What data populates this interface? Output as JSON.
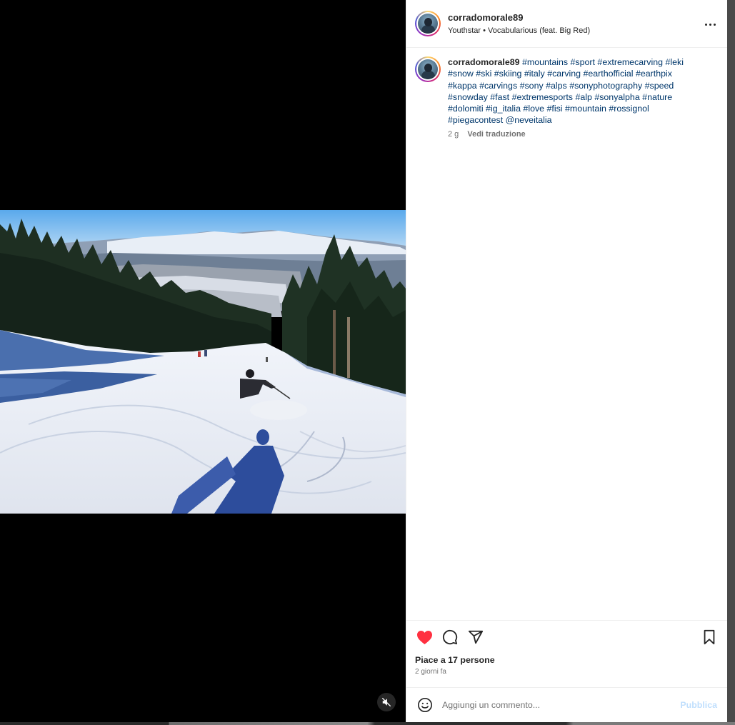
{
  "post": {
    "username": "corradomorale89",
    "audio": "Youthstar • Vocabularious (feat. Big Red)"
  },
  "caption": {
    "username": "corradomorale89",
    "hashtags": [
      "#mountains",
      "#sport",
      "#extremecarving",
      "#leki",
      "#snow",
      "#ski",
      "#skiing",
      "#italy",
      "#carving",
      "#earthofficial",
      "#earthpix",
      "#kappa",
      "#carvings",
      "#sony",
      "#alps",
      "#sonyphotography",
      "#speed",
      "#snowday",
      "#fast",
      "#extremesports",
      "#alp",
      "#sonyalpha",
      "#nature",
      "#dolomiti",
      "#ig_italia",
      "#love",
      "#fisi",
      "#mountain",
      "#rossignol",
      "#piegacontest",
      "@neveitalia"
    ],
    "age": "2 g",
    "translate_label": "Vedi traduzione"
  },
  "actions": {
    "liked": true,
    "like_color": "#ff3040",
    "likes_text": "Piace a 17 persone",
    "time_ago": "2 giorni fa"
  },
  "comment_box": {
    "placeholder": "Aggiungi un commento...",
    "post_label": "Pubblica"
  },
  "icons": {
    "more": "more-horizontal-icon",
    "like": "heart-filled-icon",
    "comment": "comment-bubble-icon",
    "share": "paper-plane-icon",
    "save": "bookmark-icon",
    "emoji": "emoji-smile-icon",
    "mute": "speaker-muted-icon"
  }
}
